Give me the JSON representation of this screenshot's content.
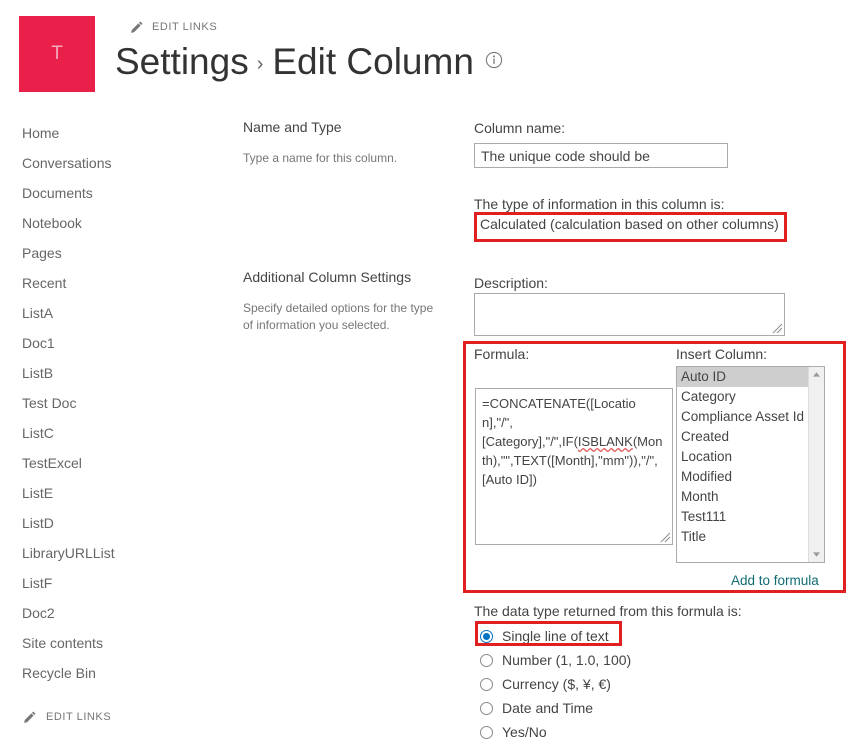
{
  "site": {
    "logo_letter": "T",
    "logo_color": "#e8204a"
  },
  "header": {
    "edit_links_top": "EDIT LINKS",
    "edit_links_bottom": "EDIT LINKS",
    "title_parent": "Settings",
    "title_separator": "›",
    "title_current": "Edit Column",
    "info_icon": "info-circle-icon"
  },
  "sidebar": {
    "items": [
      {
        "label": "Home"
      },
      {
        "label": "Conversations"
      },
      {
        "label": "Documents"
      },
      {
        "label": "Notebook"
      },
      {
        "label": "Pages"
      },
      {
        "label": "Recent"
      },
      {
        "label": "ListA"
      },
      {
        "label": "Doc1"
      },
      {
        "label": "ListB"
      },
      {
        "label": "Test Doc"
      },
      {
        "label": "ListC"
      },
      {
        "label": "TestExcel"
      },
      {
        "label": "ListE"
      },
      {
        "label": "ListD"
      },
      {
        "label": "LibraryURLList"
      },
      {
        "label": "ListF"
      },
      {
        "label": "Doc2"
      },
      {
        "label": "Site contents"
      },
      {
        "label": "Recycle Bin"
      }
    ]
  },
  "name_and_type": {
    "heading": "Name and Type",
    "description": "Type a name for this column.",
    "column_name_label": "Column name:",
    "column_name_value": "The unique code should be",
    "type_label": "The type of information in this column is:",
    "type_value": "Calculated (calculation based on other columns)"
  },
  "additional_settings": {
    "heading": "Additional Column Settings",
    "description": "Specify detailed options for the type of information you selected.",
    "description_label": "Description:",
    "description_value": "",
    "formula_label": "Formula:",
    "formula_value": "=CONCATENATE([Location],\"/\",[Category],\"/\",IF(ISBLANK(Month),\"\",TEXT([Month],\"mm\")),\"/\",[Auto ID])",
    "formula_parts": {
      "before": "=CONCATENATE([Location],\"/\",\n[Category],\"/\",IF(",
      "misspelled": "ISBLANK",
      "after": "(Month),\"\",TEXT([Month],\"mm\")),\"/\",[Auto ID])"
    },
    "insert_column_label": "Insert Column:",
    "insert_column_options": [
      "Auto ID",
      "Category",
      "Compliance Asset Id",
      "Created",
      "Location",
      "Modified",
      "Month",
      "Test111",
      "Title"
    ],
    "insert_column_selected": "Auto ID",
    "add_to_formula_link": "Add to formula",
    "datatype_label": "The data type returned from this formula is:",
    "datatype_options": [
      {
        "label": "Single line of text",
        "checked": true
      },
      {
        "label": "Number (1, 1.0, 100)",
        "checked": false
      },
      {
        "label": "Currency ($, ¥, €)",
        "checked": false
      },
      {
        "label": "Date and Time",
        "checked": false
      },
      {
        "label": "Yes/No",
        "checked": false
      }
    ]
  },
  "annotations": {
    "color": "#e02020",
    "boxes": [
      {
        "target": "type-select"
      },
      {
        "target": "formula-and-insert-column"
      },
      {
        "target": "single-line-of-text-radio"
      }
    ]
  }
}
